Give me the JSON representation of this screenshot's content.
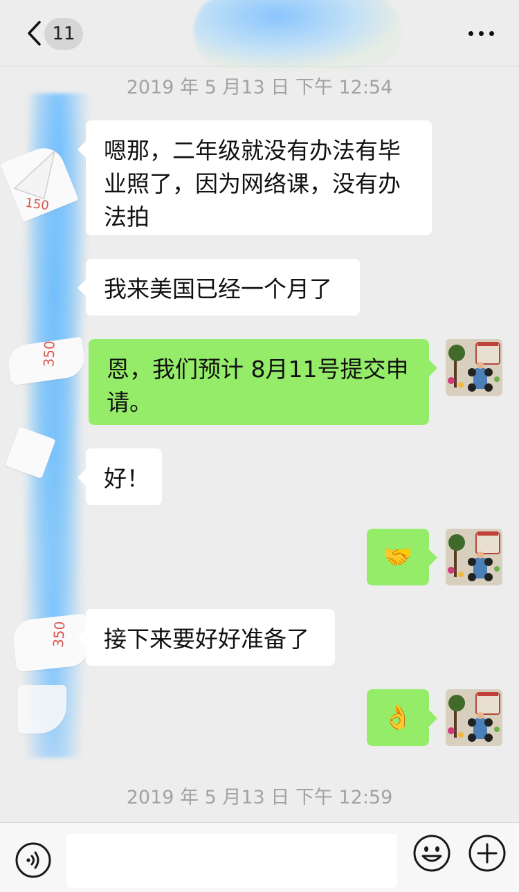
{
  "header": {
    "unread_count": "11",
    "back_icon": "chevron-left-icon",
    "more_icon": "more-dots-icon"
  },
  "timestamps": {
    "top": "2019 年 5 月13 日  下午 12:54",
    "bottom": "2019 年 5 月13 日  下午 12:59"
  },
  "messages": [
    {
      "side": "left",
      "text": "嗯那，二年级就没有办法有毕业照了，因为网络课，没有办法拍"
    },
    {
      "side": "left",
      "text": "我来美国已经一个月了"
    },
    {
      "side": "right",
      "text": "恩，我们预计 8月11号提交申请。"
    },
    {
      "side": "left",
      "text": "好！"
    },
    {
      "side": "right",
      "emoji": "handshake-emoji",
      "glyph": "🤝"
    },
    {
      "side": "left",
      "text": "接下来要好好准备了"
    },
    {
      "side": "right",
      "emoji": "ok-hand-emoji",
      "glyph": "👌"
    }
  ],
  "input_bar": {
    "voice_icon": "voice-icon",
    "emoji_icon": "smiley-icon",
    "plus_icon": "plus-icon",
    "text_value": ""
  },
  "colors": {
    "background": "#ededed",
    "sent_bubble": "#95ec69",
    "received_bubble": "#ffffff",
    "timestamp": "#a2a2a2"
  }
}
